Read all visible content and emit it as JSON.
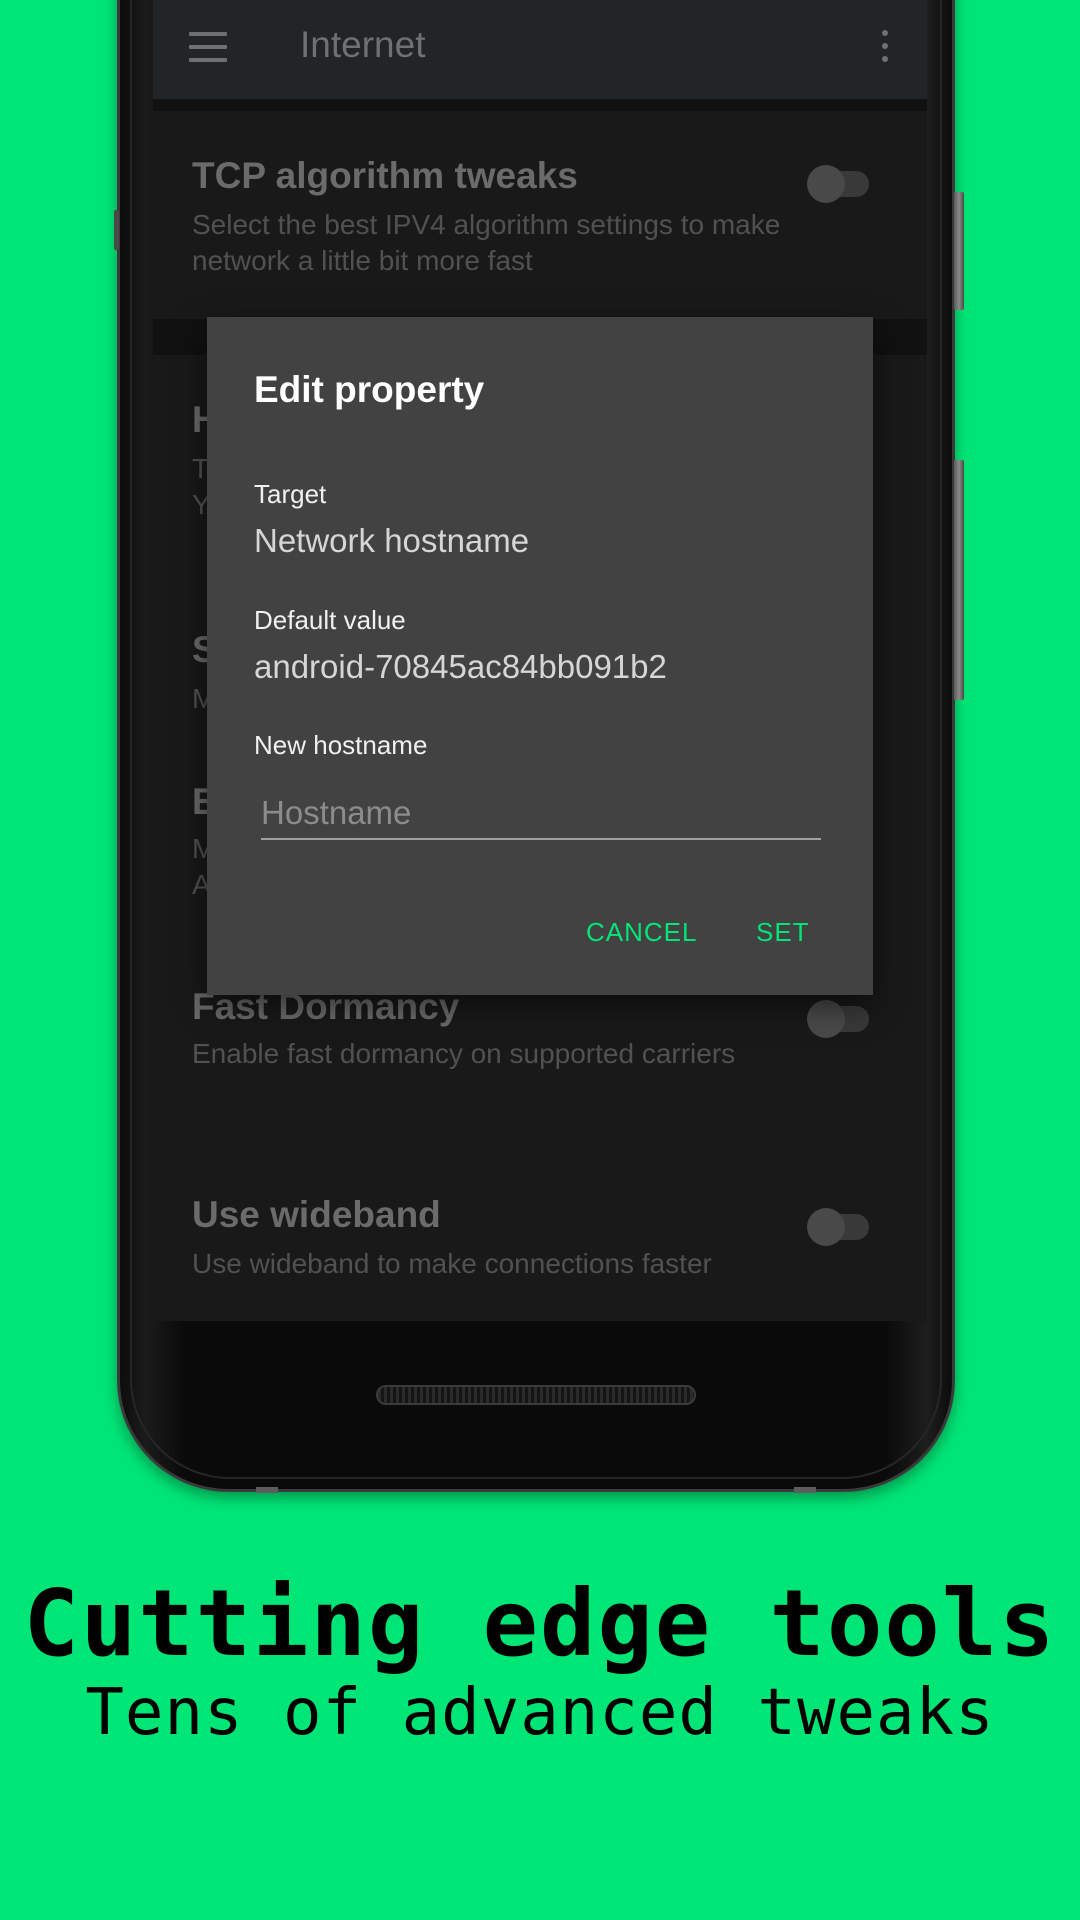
{
  "appbar": {
    "title": "Internet"
  },
  "settings": [
    {
      "title": "TCP algorithm tweaks",
      "desc": "Select the best IPV4 algorithm settings to make network a little bit more fast"
    },
    {
      "title": "H",
      "desc": "T\nY"
    },
    {
      "title": "S",
      "desc": "M"
    },
    {
      "title": "E",
      "desc": "M\nA"
    },
    {
      "title": "Fast Dormancy",
      "desc": "Enable fast dormancy on supported carriers"
    },
    {
      "title": "Use wideband",
      "desc": "Use wideband to make connections faster"
    }
  ],
  "dialog": {
    "title": "Edit property",
    "target_label": "Target",
    "target_value": "Network hostname",
    "default_label": "Default value",
    "default_value": "android-70845ac84bb091b2",
    "new_label": "New hostname",
    "input_placeholder": "Hostname",
    "cancel_label": "CANCEL",
    "set_label": "SET"
  },
  "caption": {
    "title": "Cutting edge tools",
    "subtitle": "Tens of advanced tweaks"
  },
  "colors": {
    "background": "#00e676",
    "accent": "#00e676",
    "dialog": "#424242",
    "appbar": "#2b3033"
  },
  "icons": [
    "menu-icon",
    "more-vert-icon"
  ]
}
